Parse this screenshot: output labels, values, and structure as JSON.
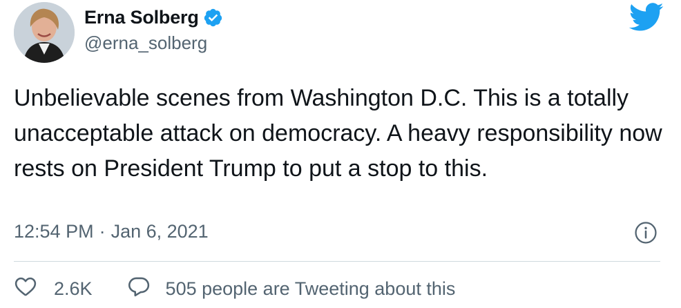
{
  "author": {
    "name": "Erna Solberg",
    "handle": "@erna_solberg",
    "verified_icon": "verified-badge-icon",
    "avatar_icon": "avatar"
  },
  "brand": {
    "icon": "twitter-bird-icon",
    "color": "#1da1f2"
  },
  "tweet": {
    "text": "Unbelievable scenes from Washington D.C. This is a totally unacceptable attack on democracy. A heavy responsibility now rests on President Trump to put a stop to this.",
    "time": "12:54 PM",
    "separator": "·",
    "date": "Jan 6, 2021"
  },
  "actions": {
    "like_count": "2.6K",
    "conversation_text": "505 people are Tweeting about this"
  },
  "colors": {
    "text": "#0f1419",
    "secondary_text": "#536471",
    "divider": "#cfd9de",
    "accent": "#1da1f2"
  }
}
